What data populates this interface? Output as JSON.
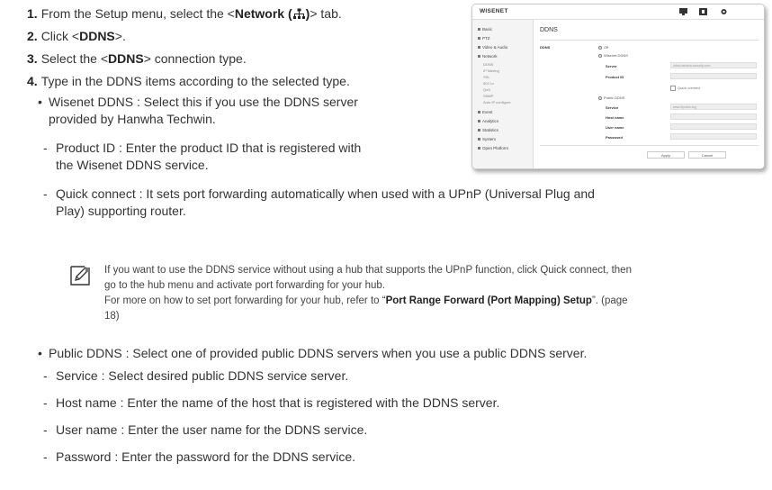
{
  "steps": [
    {
      "num": "1.",
      "pre": "From the Setup menu, select the <",
      "bold": "Network (",
      "bold_after": ")",
      "post": "> tab."
    },
    {
      "num": "2.",
      "pre": "Click <",
      "bold": "DDNS",
      "post": ">."
    },
    {
      "num": "3.",
      "pre": "Select the <",
      "bold": "DDNS",
      "post": "> connection type."
    },
    {
      "num": "4.",
      "text": "Type in the DDNS items according to the selected type."
    }
  ],
  "wisenet": {
    "line1": "Wisenet DDNS : Select this if you use the DDNS server",
    "line2": "provided by Hanwha Techwin.",
    "product_id_line1": "Product ID : Enter the product ID that is registered with",
    "product_id_line2": "the Wisenet DDNS service.",
    "quick_line1": "Quick connect : It sets port forwarding automatically when used with a UPnP (Universal Plug and",
    "quick_line2": "Play) supporting router."
  },
  "note": {
    "line1": "If you want to use the DDNS service without using a hub that supports the UPnP function, click Quick connect, then",
    "line2": "go to the hub menu and activate port forwarding for your hub.",
    "line3_pre": "For more on how to set port forwarding for your hub, refer to “",
    "line3_bold": "Port Range Forward (Port Mapping) Setup",
    "line3_post": "”. (page",
    "line4": "18)"
  },
  "public": {
    "line1": "Public DDNS : Select one of provided public DDNS servers when you use a public DDNS server.",
    "service": "Service : Select desired public DDNS service server.",
    "host": "Host name : Enter the name of the host that is registered with the DDNS server.",
    "user": "User name : Enter the user name for the DDNS service.",
    "password": "Password : Enter the password for the DDNS service."
  },
  "screenshot": {
    "logo": "WISENET",
    "page_title": "DDNS",
    "ddns_label": "DDNS",
    "opt_off": "Off",
    "opt_wisenet": "Wisenet DDNS",
    "server_label": "Server",
    "server_value": "ddns.hanwha-security.com",
    "product_id_label": "Product ID",
    "quick_connect": "Quick connect",
    "opt_public": "Public DDNS",
    "service_label": "Service",
    "service_value": "www.dyndns.org",
    "host_label": "Host name",
    "user_label": "User name",
    "password_label": "Password",
    "apply": "Apply",
    "cancel": "Cancel",
    "side_items": [
      "Basic",
      "PTZ",
      "Video & Audio",
      "Network"
    ],
    "side_subs": [
      "DDNS",
      "IP filtering",
      "SSL",
      "802.1x",
      "QoS",
      "SNMP",
      "Auto IP configure"
    ],
    "side_items2": [
      "Event",
      "Analytics",
      "Statistics",
      "System",
      "Open Platform"
    ]
  }
}
